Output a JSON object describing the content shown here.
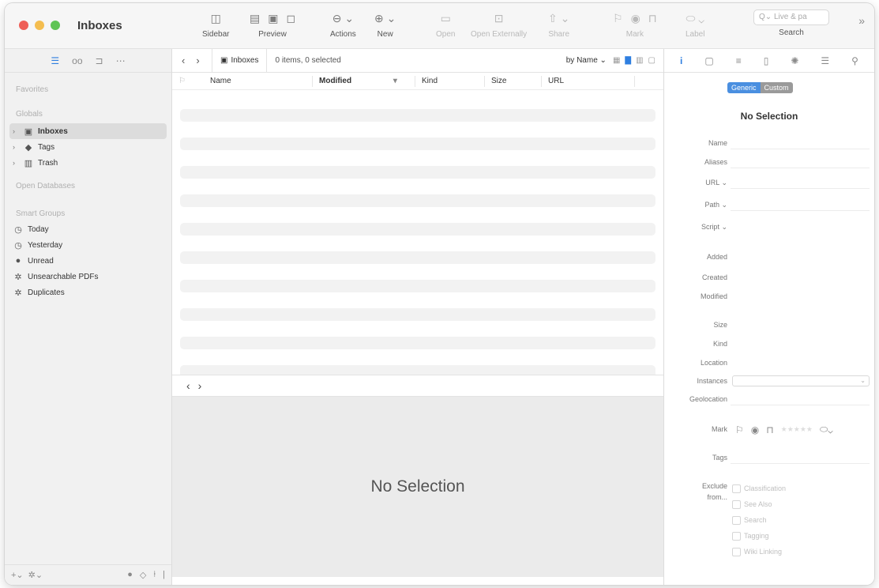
{
  "window": {
    "title": "Inboxes"
  },
  "toolbar": {
    "sidebar_label": "Sidebar",
    "preview_label": "Preview",
    "actions_label": "Actions",
    "new_label": "New",
    "open_label": "Open",
    "open_externally_label": "Open Externally",
    "share_label": "Share",
    "mark_label": "Mark",
    "label_label": "Label",
    "search_label": "Search",
    "search_placeholder": "Live & pa"
  },
  "sidebar": {
    "favorites": "Favorites",
    "globals": "Globals",
    "globals_items": [
      {
        "label": "Inboxes",
        "icon": "inbox-icon"
      },
      {
        "label": "Tags",
        "icon": "tag-icon"
      },
      {
        "label": "Trash",
        "icon": "trash-icon"
      }
    ],
    "open_databases": "Open Databases",
    "smart_groups": "Smart Groups",
    "smart_items": [
      {
        "label": "Today",
        "icon": "clock-icon"
      },
      {
        "label": "Yesterday",
        "icon": "clock-icon"
      },
      {
        "label": "Unread",
        "icon": "unread-dot-icon"
      },
      {
        "label": "Unsearchable PDFs",
        "icon": "gear-icon"
      },
      {
        "label": "Duplicates",
        "icon": "gear-icon"
      }
    ]
  },
  "pathbar": {
    "crumb": "Inboxes",
    "count": "0 items, 0 selected",
    "sort": "by Name"
  },
  "columns": {
    "name": "Name",
    "modified": "Modified",
    "kind": "Kind",
    "size": "Size",
    "url": "URL"
  },
  "preview": {
    "empty_text": "No Selection"
  },
  "inspector": {
    "seg_generic": "Generic",
    "seg_custom": "Custom",
    "title": "No Selection",
    "fields": {
      "name": "Name",
      "aliases": "Aliases",
      "url": "URL",
      "path": "Path",
      "script": "Script",
      "added": "Added",
      "created": "Created",
      "modified": "Modified",
      "size": "Size",
      "kind": "Kind",
      "location": "Location",
      "instances": "Instances",
      "geolocation": "Geolocation",
      "mark": "Mark",
      "tags": "Tags",
      "exclude": "Exclude",
      "from": "from..."
    },
    "exclude_options": [
      "Classification",
      "See Also",
      "Search",
      "Tagging",
      "Wiki Linking"
    ]
  }
}
